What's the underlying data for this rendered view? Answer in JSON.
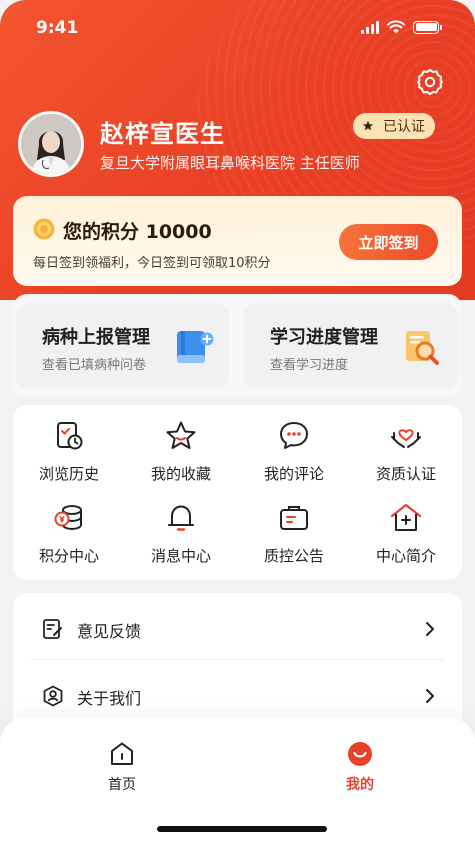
{
  "status_bar": {
    "time": "9:41"
  },
  "profile": {
    "name": "赵梓宣医生",
    "hospital_line": "复旦大学附属眼耳鼻喉科医院 主任医师",
    "verified_label": "已认证"
  },
  "points": {
    "title": "您的积分 10000",
    "description": "每日签到领福利，今日签到可领取10积分",
    "signin_button": "立即签到"
  },
  "management": [
    {
      "title": "病种上报管理",
      "subtitle": "查看已填病种问卷",
      "icon": "book-plus-icon"
    },
    {
      "title": "学习进度管理",
      "subtitle": "查看学习进度",
      "icon": "document-search-icon"
    }
  ],
  "grid": [
    {
      "label": "浏览历史",
      "icon": "history-icon"
    },
    {
      "label": "我的收藏",
      "icon": "star-icon"
    },
    {
      "label": "我的评论",
      "icon": "comment-icon"
    },
    {
      "label": "资质认证",
      "icon": "heart-hands-icon"
    },
    {
      "label": "积分中心",
      "icon": "coins-icon"
    },
    {
      "label": "消息中心",
      "icon": "bell-icon"
    },
    {
      "label": "质控公告",
      "icon": "briefcase-icon"
    },
    {
      "label": "中心简介",
      "icon": "house-plus-icon"
    }
  ],
  "list": [
    {
      "label": "意见反馈",
      "icon": "feedback-icon"
    },
    {
      "label": "关于我们",
      "icon": "about-user-icon"
    }
  ],
  "tabbar": {
    "home_label": "首页",
    "mine_label": "我的"
  },
  "colors": {
    "brand": "#e93f25",
    "accent_gold": "#f5a623",
    "active_tab": "#e8432a"
  }
}
